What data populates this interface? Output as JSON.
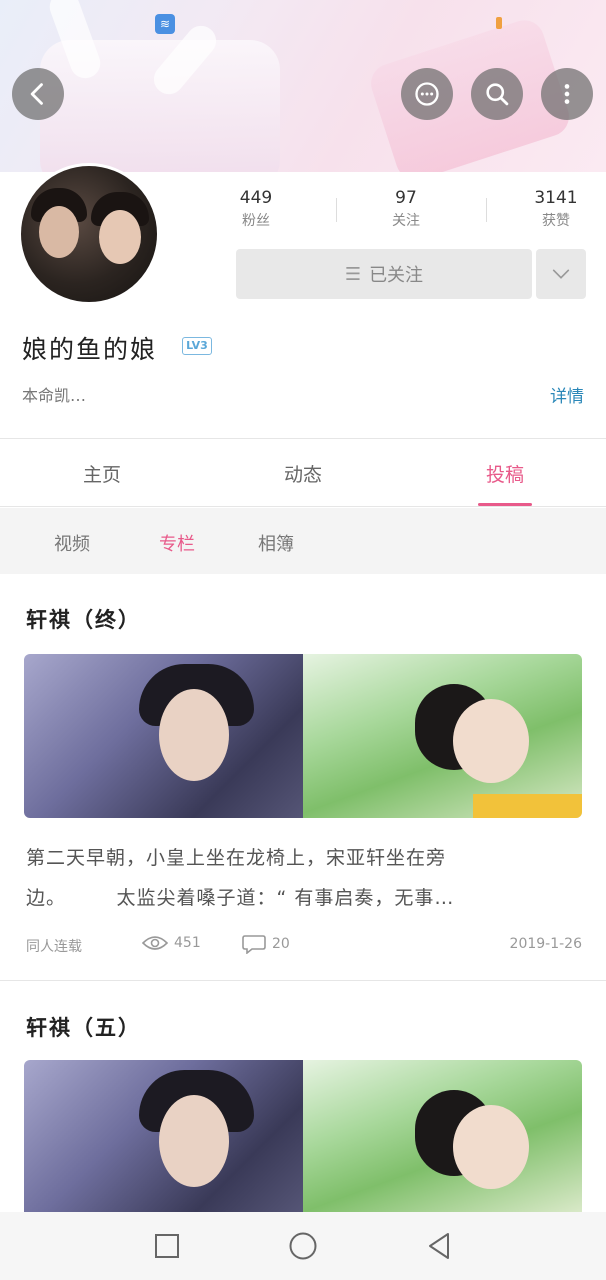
{
  "header": {
    "status_icon": "wifi-icon",
    "buttons": [
      "back-icon",
      "message-icon",
      "search-icon",
      "more-icon"
    ]
  },
  "profile": {
    "stats": [
      {
        "value": "449",
        "label": "粉丝"
      },
      {
        "value": "97",
        "label": "关注"
      },
      {
        "value": "3141",
        "label": "获赞"
      }
    ],
    "follow_label": "已关注",
    "username": "娘的鱼的娘",
    "level": "LV3",
    "bio": "本命凯…",
    "details_label": "详情"
  },
  "tabs": [
    {
      "label": "主页"
    },
    {
      "label": "动态"
    },
    {
      "label": "投稿",
      "active": true
    }
  ],
  "subtabs": [
    {
      "label": "视频"
    },
    {
      "label": "专栏",
      "active": true
    },
    {
      "label": "相簿"
    }
  ],
  "articles": [
    {
      "title": "轩祺（终）",
      "excerpt_line1": "第二天早朝，小皇上坐在龙椅上，宋亚轩坐在旁",
      "excerpt_line2": "边。　　　太监尖着嗓子道：“ 有事启奏，无事…",
      "category": "同人连载",
      "views": "451",
      "comments": "20",
      "date": "2019-1-26"
    },
    {
      "title": "轩祺（五）"
    }
  ],
  "colors": {
    "accent": "#e85a8a",
    "link": "#2a87b8",
    "level": "#5aa7d8"
  }
}
